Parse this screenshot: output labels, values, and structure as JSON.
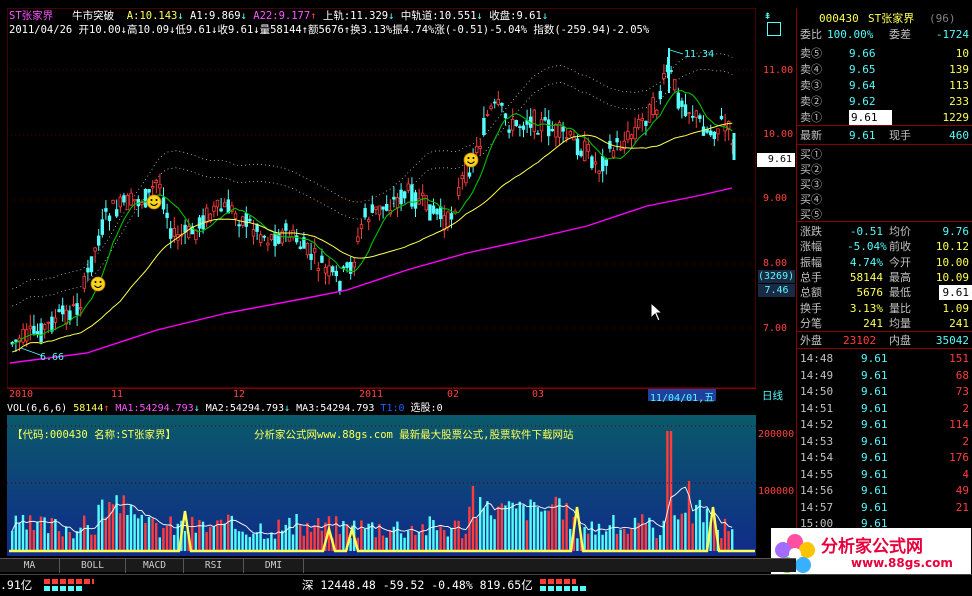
{
  "header": {
    "stock_name": "ST张家界",
    "indicator_name": "牛市突破",
    "a_label": "A:",
    "a_value": "10.143",
    "a1_label": "A1:",
    "a1_value": "9.869",
    "a22_label": "A22:",
    "a22_value": "9.177",
    "upper_label": "上轨:",
    "upper_value": "11.329",
    "mid_label": "中轨道:",
    "mid_value": "10.551",
    "close_label": "收盘:",
    "close_value": "9.61",
    "line2": "2011/04/26  开10.00↓高10.09↓低9.61↓收9.61↓量58144↑额5676↑换3.13%振4.74%涨(-0.51)-5.04% 指数(-259.94)-2.05%"
  },
  "price_axis": {
    "labels": [
      "11.00",
      "10.00",
      "9.00",
      "8.00",
      "7.00"
    ],
    "current": "9.61",
    "aux1": "(3269)",
    "aux2": "7.46"
  },
  "annotations": {
    "high": "11.34",
    "low": "6.66"
  },
  "date_axis": {
    "labels": [
      "2010",
      "11",
      "12",
      "2011",
      "02",
      "03"
    ],
    "cursor": "11/04/01,五",
    "period": "日线"
  },
  "volume": {
    "header_vol": "VOL(6,6,6)",
    "vol_value": "58144",
    "ma1": "MA1:54294.793",
    "ma2": "MA2:54294.793",
    "ma3": "MA3:54294.793",
    "extra": "T1:0",
    "pick": "选股:0",
    "code_line": "【代码:000430 名称:ST张家界】",
    "site_line": "分析家公式网www.88gs.com 最新最大股票公式,股票软件下载网站",
    "axis": [
      "200000",
      "100000"
    ]
  },
  "quote": {
    "code": "000430",
    "name": "ST张家界",
    "tag": "(96)",
    "weibi_label": "委比",
    "weibi_value": "100.00%",
    "weicha_label": "委差",
    "weicha_value": "-1724",
    "asks": [
      {
        "label": "卖⑤",
        "price": "9.66",
        "vol": "10"
      },
      {
        "label": "卖④",
        "price": "9.65",
        "vol": "139"
      },
      {
        "label": "卖③",
        "price": "9.64",
        "vol": "113"
      },
      {
        "label": "卖②",
        "price": "9.62",
        "vol": "233"
      },
      {
        "label": "卖①",
        "price": "9.61",
        "vol": "1229"
      }
    ],
    "latest_label": "最新",
    "latest_value": "9.61",
    "xianshou_label": "现手",
    "xianshou_value": "460",
    "bids": [
      "买①",
      "买②",
      "买③",
      "买④",
      "买⑤"
    ],
    "stats": [
      {
        "l1": "涨跌",
        "v1": "-0.51",
        "l2": "均价",
        "v2": "9.76"
      },
      {
        "l1": "涨幅",
        "v1": "-5.04%",
        "l2": "前收",
        "v2": "10.12"
      },
      {
        "l1": "振幅",
        "v1": "4.74%",
        "l2": "今开",
        "v2": "10.00"
      },
      {
        "l1": "总手",
        "v1": "58144",
        "l2": "最高",
        "v2": "10.09"
      },
      {
        "l1": "总额",
        "v1": "5676",
        "l2": "最低",
        "v2": "9.61"
      },
      {
        "l1": "换手",
        "v1": "3.13%",
        "l2": "量比",
        "v2": "1.09"
      },
      {
        "l1": "分笔",
        "v1": "241",
        "l2": "均量",
        "v2": "241"
      }
    ],
    "outer_label": "外盘",
    "outer_value": "23102",
    "inner_label": "内盘",
    "inner_value": "35042"
  },
  "ticks": [
    {
      "time": "14:48",
      "price": "9.61",
      "vol": "151"
    },
    {
      "time": "14:49",
      "price": "9.61",
      "vol": "68"
    },
    {
      "time": "14:50",
      "price": "9.61",
      "vol": "73"
    },
    {
      "time": "14:51",
      "price": "9.61",
      "vol": "2"
    },
    {
      "time": "14:52",
      "price": "9.61",
      "vol": "114"
    },
    {
      "time": "14:53",
      "price": "9.61",
      "vol": "2"
    },
    {
      "time": "14:54",
      "price": "9.61",
      "vol": "176"
    },
    {
      "time": "14:55",
      "price": "9.61",
      "vol": "4"
    },
    {
      "time": "14:56",
      "price": "9.61",
      "vol": "49"
    },
    {
      "time": "14:57",
      "price": "9.61",
      "vol": "21"
    },
    {
      "time": "15:00",
      "price": "9.61",
      "vol": ""
    }
  ],
  "tabs": [
    "MA",
    "BOLL",
    "MACD",
    "RSI",
    "DMI"
  ],
  "status": {
    "left": ".91亿",
    "shen": "深 12448.48 -59.52 -0.48% 819.65亿"
  },
  "logo": {
    "text": "分析家公式网",
    "url_text": "www.88gs.com"
  },
  "colors": {
    "up": "#ff3c3c",
    "down": "#54fcfc",
    "yellow": "#ffff54",
    "ma_green": "#00c000",
    "ma_purple": "#ff00ff"
  }
}
